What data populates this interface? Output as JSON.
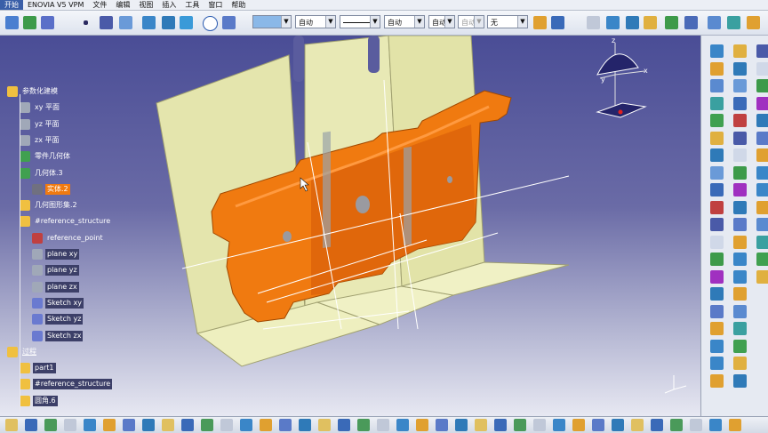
{
  "menu": [
    "开始",
    "ENOVIA V5 VPM",
    "文件",
    "编辑",
    "视图",
    "插入",
    "工具",
    "窗口",
    "帮助"
  ],
  "toolbar": {
    "linetype_select": "自动",
    "thickness_select": "自动",
    "layer_select": "自动",
    "style_select": "自动",
    "none_select": "无"
  },
  "tree": [
    {
      "label": "参数化建模",
      "indent": 0,
      "style": "plain",
      "icon": "product-icon"
    },
    {
      "label": "xy 平面",
      "indent": 1,
      "style": "plain",
      "icon": "plane-icon"
    },
    {
      "label": "yz 平面",
      "indent": 1,
      "style": "plain",
      "icon": "plane-icon"
    },
    {
      "label": "zx 平面",
      "indent": 1,
      "style": "plain",
      "icon": "plane-icon"
    },
    {
      "label": "零件几何体",
      "indent": 1,
      "style": "plain",
      "icon": "gear-icon"
    },
    {
      "label": "几何体.3",
      "indent": 1,
      "style": "plain",
      "icon": "gear-icon"
    },
    {
      "label": "实体.2",
      "indent": 2,
      "style": "sel",
      "icon": "solid-icon"
    },
    {
      "label": "几何图形集.2",
      "indent": 1,
      "style": "plain",
      "icon": "set-icon"
    },
    {
      "label": "#reference_structure",
      "indent": 1,
      "style": "plain",
      "icon": "set-icon"
    },
    {
      "label": "reference_point",
      "indent": 2,
      "style": "plain",
      "icon": "point-icon"
    },
    {
      "label": "plane xy",
      "indent": 2,
      "style": "hl",
      "icon": "plane-icon"
    },
    {
      "label": "plane yz",
      "indent": 2,
      "style": "hl",
      "icon": "plane-icon"
    },
    {
      "label": "plane zx",
      "indent": 2,
      "style": "hl",
      "icon": "plane-icon"
    },
    {
      "label": "Sketch xy",
      "indent": 2,
      "style": "hl",
      "icon": "sketch-icon"
    },
    {
      "label": "Sketch yz",
      "indent": 2,
      "style": "hl",
      "icon": "sketch-icon"
    },
    {
      "label": "Sketch zx",
      "indent": 2,
      "style": "hl",
      "icon": "sketch-icon"
    },
    {
      "label": "过程",
      "indent": 0,
      "style": "ul",
      "icon": "process-icon"
    },
    {
      "label": "part1",
      "indent": 1,
      "style": "hl",
      "icon": "process-icon"
    },
    {
      "label": "#reference_structure",
      "indent": 1,
      "style": "hl",
      "icon": "set-icon"
    },
    {
      "label": "圆角.6",
      "indent": 1,
      "style": "hl",
      "icon": "fillet-icon"
    }
  ],
  "compass": {
    "x_label": "x",
    "y_label": "y",
    "z_label": "z"
  },
  "colors": {
    "part": "#f07a10",
    "surface": "#e6e7b0",
    "selection": "#f07a10"
  }
}
